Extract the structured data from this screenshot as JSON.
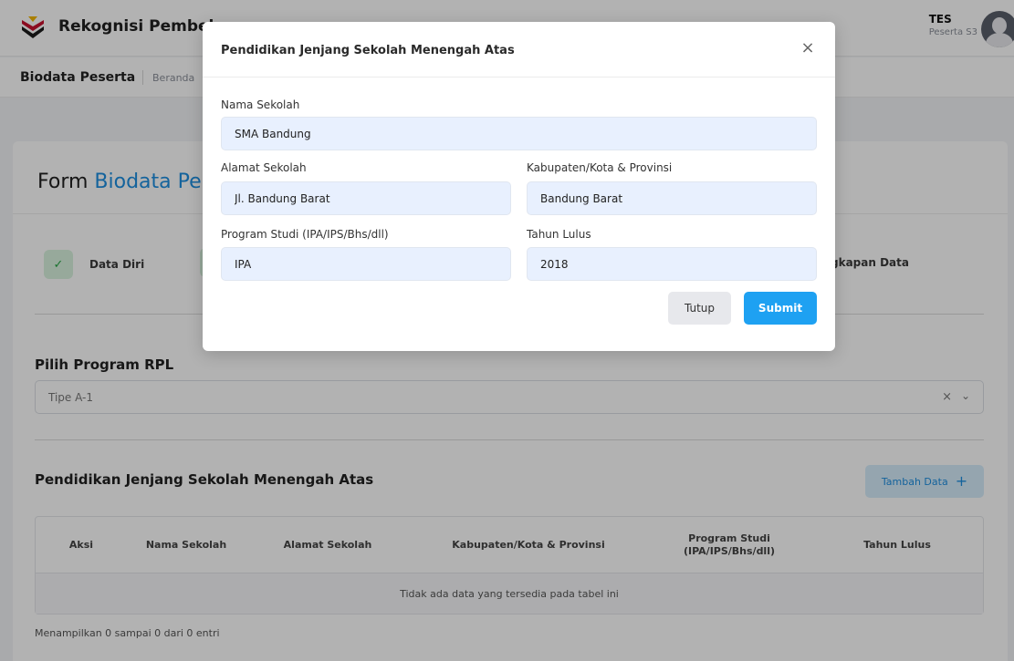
{
  "app": {
    "title": "Rekognisi Pembela",
    "user_name": "TES",
    "user_role": "Peserta S3"
  },
  "subheader": {
    "title": "Biodata Peserta",
    "breadcrumb": "Beranda"
  },
  "form": {
    "title_prefix": "Form",
    "title_accent": "Biodata Pe",
    "steps": [
      {
        "label": "Data Diri",
        "icon": "check-icon"
      }
    ],
    "step_right_label": "gkapan Data"
  },
  "rpl": {
    "label": "Pilih Program RPL",
    "selected": "Tipe A-1",
    "clear_glyph": "×",
    "chevron_glyph": "⌄"
  },
  "section": {
    "title": "Pendidikan Jenjang Sekolah Menengah Atas",
    "add_label": "Tambah Data",
    "add_glyph": "+"
  },
  "table": {
    "columns": [
      {
        "line1": "Aksi",
        "line2": ""
      },
      {
        "line1": "Nama Sekolah",
        "line2": ""
      },
      {
        "line1": "Alamat Sekolah",
        "line2": ""
      },
      {
        "line1": "Kabupaten/Kota & Provinsi",
        "line2": ""
      },
      {
        "line1": "Program Studi",
        "line2": "(IPA/IPS/Bhs/dll)"
      },
      {
        "line1": "Tahun Lulus",
        "line2": ""
      }
    ],
    "empty_text": "Tidak ada data yang tersedia pada tabel ini",
    "info": "Menampilkan 0 sampai 0 dari 0 entri"
  },
  "modal": {
    "title": "Pendidikan Jenjang Sekolah Menengah Atas",
    "close_glyph": "×",
    "fields": {
      "nama_sekolah": {
        "label": "Nama Sekolah",
        "value": "SMA Bandung"
      },
      "alamat_sekolah": {
        "label": "Alamat Sekolah",
        "value": "Jl. Bandung Barat"
      },
      "kabupaten": {
        "label": "Kabupaten/Kota & Provinsi",
        "value": "Bandung Barat"
      },
      "program_studi": {
        "label": "Program Studi (IPA/IPS/Bhs/dll)",
        "value": "IPA"
      },
      "tahun_lulus": {
        "label": "Tahun Lulus",
        "value": "2018"
      }
    },
    "close_label": "Tutup",
    "submit_label": "Submit"
  },
  "colors": {
    "accent": "#1e8fe0",
    "submit": "#1ea1f2",
    "success_bg": "#d8f3df",
    "success": "#28a745",
    "input_bg": "#e8f0fe"
  }
}
